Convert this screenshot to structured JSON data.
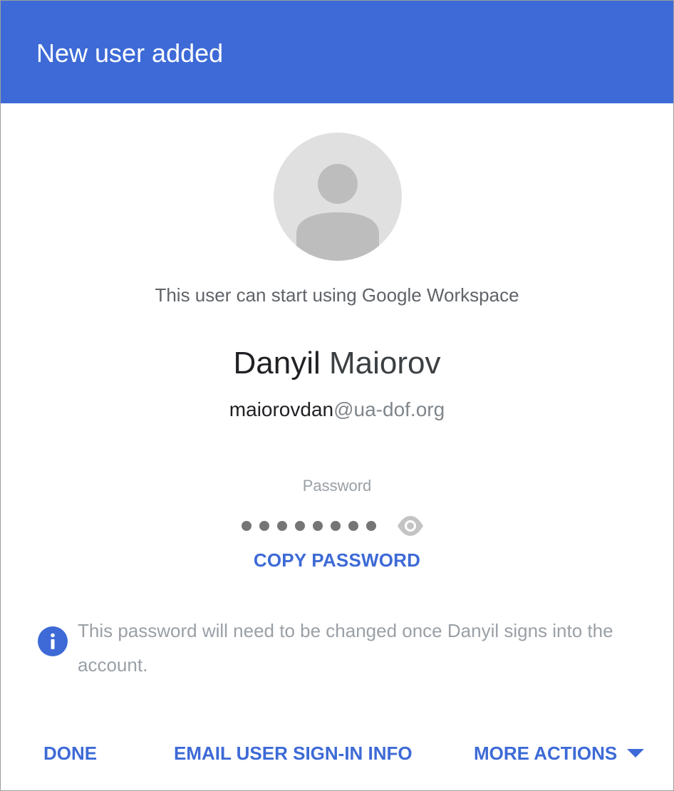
{
  "dialog": {
    "title": "New user added"
  },
  "status": {
    "message": "This user can start using Google Workspace"
  },
  "user": {
    "first_name": "Danyil",
    "last_name": "Maiorov",
    "email_local": "maiorovdan",
    "email_domain": "@ua-dof.org"
  },
  "password": {
    "label": "Password",
    "masked_length": 8,
    "copy_label": "COPY PASSWORD"
  },
  "notice": {
    "text": "This password will need to be changed once Danyil signs into the account."
  },
  "actions": {
    "done_label": "DONE",
    "email_label": "EMAIL USER SIGN-IN INFO",
    "more_label": "MORE ACTIONS"
  },
  "icons": {
    "avatar": "person-avatar-icon",
    "visibility": "eye-icon",
    "info": "info-icon",
    "dropdown": "caret-down-icon"
  },
  "colors": {
    "primary": "#3d6ad6",
    "header_text": "#ffffff",
    "muted_text": "#9aa0a6"
  }
}
